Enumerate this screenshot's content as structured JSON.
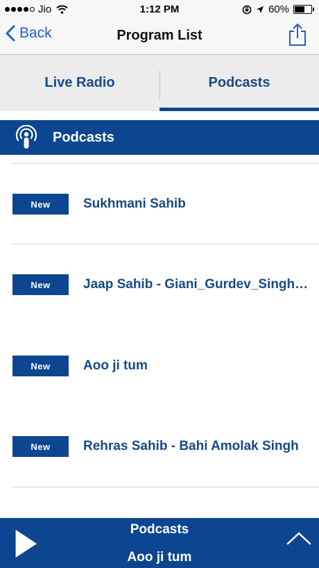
{
  "status_bar": {
    "carrier": "Jio",
    "time": "1:12 PM",
    "battery": "60%",
    "battery_level": 0.6,
    "icons": [
      "signal-dots",
      "wifi-icon",
      "rotation-lock-icon",
      "location-arrow-icon",
      "battery-icon"
    ]
  },
  "nav": {
    "back_label": "Back",
    "title": "Program List",
    "icons": [
      "chevron-left-icon",
      "share-icon"
    ]
  },
  "tabs": [
    {
      "label": "Live Radio",
      "active": false
    },
    {
      "label": "Podcasts",
      "active": true
    }
  ],
  "section": {
    "title": "Podcasts",
    "icon": "podcast-icon"
  },
  "list": {
    "items": [
      {
        "badge": "New",
        "title": "Sukhmani Sahib"
      },
      {
        "badge": "New",
        "title": "Jaap Sahib - Giani_Gurdev_Singh_Ji"
      },
      {
        "badge": "New",
        "title": "Aoo ji tum"
      },
      {
        "badge": "New",
        "title": "Rehras Sahib - Bahi Amolak Singh"
      }
    ]
  },
  "player": {
    "title": "Podcasts",
    "subtitle": "Aoo ji tum",
    "icons": [
      "play-icon",
      "chevron-up-icon"
    ]
  },
  "colors": {
    "brand_blue": "#0d4690",
    "text_blue": "#174a86",
    "ios_link_blue": "#1f5fc7",
    "tab_bg": "#ececec",
    "bar_bg": "#f7f7f7"
  }
}
